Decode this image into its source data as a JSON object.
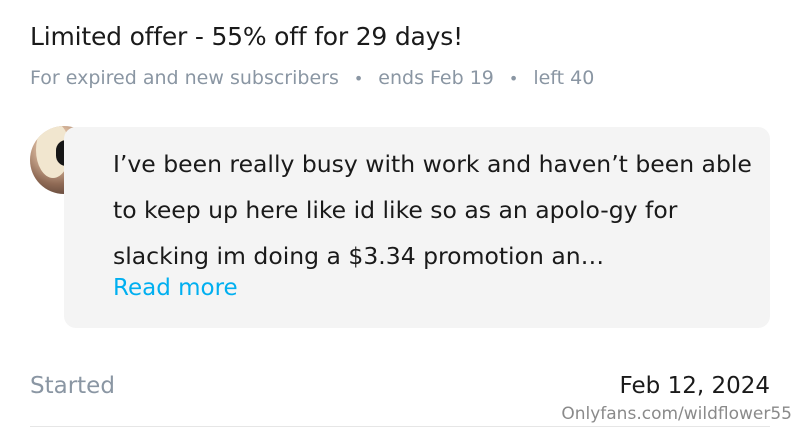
{
  "offer": {
    "title": "Limited offer - 55% off for 29 days!",
    "audience": "For expired and new subscribers",
    "ends": "ends Feb 19",
    "left": "left 40",
    "separator": "•"
  },
  "message": {
    "text": "I’ve been really busy with work and haven’t been able to keep up here like id like so as an apolo-gy for slacking im doing a $3.34 promotion an…",
    "read_more": "Read more"
  },
  "started": {
    "label": "Started",
    "date": "Feb 12, 2024"
  },
  "watermark": "Onlyfans.com/wildflower55",
  "colors": {
    "accent": "#00aff0",
    "muted": "#8a96a3",
    "bubble_bg": "#f4f4f4"
  }
}
